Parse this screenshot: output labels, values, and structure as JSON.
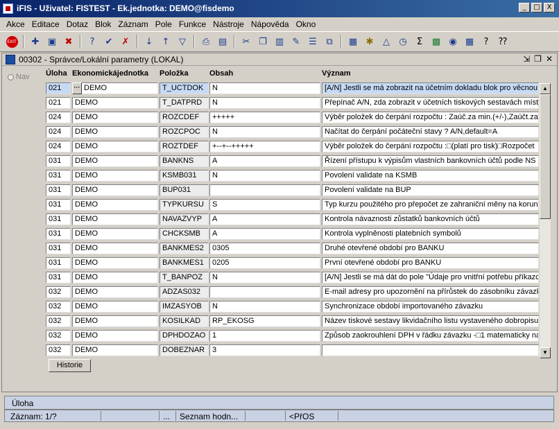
{
  "window": {
    "title": "iFIS - Uživatel: FISTEST - Ek.jednotka: DEMO@fisdemo",
    "minimize": "_",
    "maximize": "□",
    "close": "X"
  },
  "menu": [
    "Akce",
    "Editace",
    "Dotaz",
    "Blok",
    "Záznam",
    "Pole",
    "Funkce",
    "Nástroje",
    "Nápověda",
    "Okno"
  ],
  "toolbar_icons": [
    "exit-icon",
    "new-record-icon",
    "save-icon",
    "delete-record-icon",
    "enter-query-icon",
    "execute-query-icon",
    "cancel-query-icon",
    "sort-asc-icon",
    "sort-desc-icon",
    "filter-icon",
    "print-icon",
    "print-setup-icon",
    "cut-icon",
    "copy-icon",
    "paste-icon",
    "edit-icon",
    "insert-row-icon",
    "duplicate-icon",
    "calculator-icon",
    "gear-icon",
    "warning-icon",
    "clock-icon",
    "sum-icon",
    "excel-icon",
    "browser-icon",
    "grid-icon",
    "help-icon",
    "context-help-icon"
  ],
  "form": {
    "title": "00302 - Správce/Lokální parametry (LOKAL)",
    "nav_label": "Nav"
  },
  "columns": {
    "uloha": "Úloha",
    "ekon": "Ekonomickájednotka",
    "polozka": "Položka",
    "obsah": "Obsah",
    "vyznam": "Význam"
  },
  "rows": [
    {
      "uloha": "021",
      "ekon": "DEMO",
      "polozka": "T_UCTDOK",
      "obsah": "N",
      "vyznam": "[A/N]  Jestli se má zobrazit na účetním dokladu blok pro věcnou l"
    },
    {
      "uloha": "021",
      "ekon": "DEMO",
      "polozka": "T_DATPRD",
      "obsah": "N",
      "vyznam": "Přepínač A/N, zda zobrazit v účetních tiskových sestavách místo"
    },
    {
      "uloha": "024",
      "ekon": "DEMO",
      "polozka": "ROZCDEF",
      "obsah": "+++++",
      "vyznam": "Výběr položek do čerpání rozpočtu : Zaúč.za min.(+/-),Zaúčt.za"
    },
    {
      "uloha": "024",
      "ekon": "DEMO",
      "polozka": "ROZCPOC",
      "obsah": "N",
      "vyznam": "Načítat do čerpání počáteční stavy ? A/N,default=A"
    },
    {
      "uloha": "024",
      "ekon": "DEMO",
      "polozka": "ROZTDEF",
      "obsah": "+--+--+++++",
      "vyznam": "Výběr položek do čerpání rozpočtu :□(platí pro tisk)□Rozpočet"
    },
    {
      "uloha": "031",
      "ekon": "DEMO",
      "polozka": "BANKNS",
      "obsah": "A",
      "vyznam": "Řízení přístupu k výpisům vlastních bankovních účtů podle NS (A"
    },
    {
      "uloha": "031",
      "ekon": "DEMO",
      "polozka": "KSMB031",
      "obsah": "N",
      "vyznam": "Povolení validate na KSMB"
    },
    {
      "uloha": "031",
      "ekon": "DEMO",
      "polozka": "BUP031",
      "obsah": "",
      "vyznam": "Povolení validate na BUP"
    },
    {
      "uloha": "031",
      "ekon": "DEMO",
      "polozka": "TYPKURSU",
      "obsah": "S",
      "vyznam": "Typ kurzu použitého pro přepočet ze zahraniční měny na koruny"
    },
    {
      "uloha": "031",
      "ekon": "DEMO",
      "polozka": "NAVAZVYP",
      "obsah": "A",
      "vyznam": "Kontrola návaznosti zůstatků bankovních účtů"
    },
    {
      "uloha": "031",
      "ekon": "DEMO",
      "polozka": "CHCKSMB",
      "obsah": "A",
      "vyznam": "Kontrola vyplněnosti platebních symbolů"
    },
    {
      "uloha": "031",
      "ekon": "DEMO",
      "polozka": "BANKMES2",
      "obsah": "0305",
      "vyznam": "Druhé otevřené období pro BANKU"
    },
    {
      "uloha": "031",
      "ekon": "DEMO",
      "polozka": "BANKMES1",
      "obsah": "0205",
      "vyznam": "První otevřené období pro BANKU"
    },
    {
      "uloha": "031",
      "ekon": "DEMO",
      "polozka": "T_BANPOZ",
      "obsah": "N",
      "vyznam": "[A/N]  Jestli se má dát do pole \"Údaje pro vnitřní potřebu příkazce"
    },
    {
      "uloha": "032",
      "ekon": "DEMO",
      "polozka": "ADZAS032",
      "obsah": "",
      "vyznam": "E-mail adresy pro upozornění na přírůstek do zásobníku závazků"
    },
    {
      "uloha": "032",
      "ekon": "DEMO",
      "polozka": "IMZASYOB",
      "obsah": "N",
      "vyznam": "Synchronizace období importovaného závazku"
    },
    {
      "uloha": "032",
      "ekon": "DEMO",
      "polozka": "KOSILKAD",
      "obsah": "RP_EKOSG",
      "vyznam": "Název tiskové sestavy likvidačního listu vystaveného dobropisu"
    },
    {
      "uloha": "032",
      "ekon": "DEMO",
      "polozka": "DPHDOZAO",
      "obsah": "1",
      "vyznam": "Způsob zaokrouhlení DPH v řádku závazku -□1 matematicky na"
    },
    {
      "uloha": "032",
      "ekon": "DEMO",
      "polozka": "DOBEZNAR",
      "obsah": "3",
      "vyznam": ""
    }
  ],
  "buttons": {
    "historie": "Historie",
    "lov": "···",
    "scroll_up": "▲",
    "scroll_down": "▼"
  },
  "status": {
    "field": "Úloha",
    "record": "Záznam: 1/?",
    "dots": "...",
    "list": "Seznam hodn...",
    "mode": "<PřOS"
  }
}
